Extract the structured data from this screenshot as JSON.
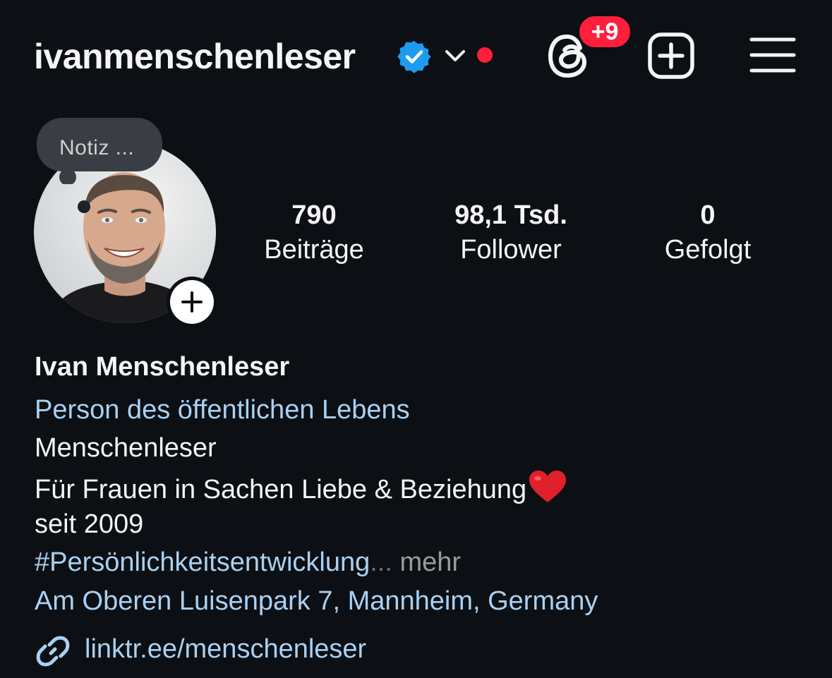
{
  "header": {
    "username": "ivanmenschenleser",
    "notifications_badge": "+9"
  },
  "note": {
    "placeholder": "Notiz ..."
  },
  "stats": [
    {
      "value": "790",
      "label": "Beiträge"
    },
    {
      "value": "98,1 Tsd.",
      "label": "Follower"
    },
    {
      "value": "0",
      "label": "Gefolgt"
    }
  ],
  "bio": {
    "name": "Ivan Menschenleser",
    "category": "Person des öffentlichen Lebens",
    "line1": "Menschenleser",
    "line2": "Für Frauen in Sachen Liebe & Beziehung",
    "line2_emoji": "heart-emoji",
    "line3": "seit 2009",
    "hashtag": "#Persönlichkeitsentwicklung",
    "ellipsis": "...",
    "more": "mehr",
    "address": "Am Oberen Luisenpark 7, Mannheim, Germany",
    "link": "linktr.ee/menschenleser"
  },
  "icons": {
    "verified": "verified-badge-icon",
    "dropdown": "chevron-down-icon",
    "threads": "threads-icon",
    "create": "plus-square-icon",
    "menu": "hamburger-menu-icon",
    "add_story": "plus-icon",
    "link": "link-icon"
  },
  "colors": {
    "background": "#0c0f14",
    "text": "#f5f5f5",
    "link_blue": "#a9d1f2",
    "verified_blue": "#1d9bf0",
    "badge_red": "#ff1f3d",
    "muted": "#9a9a9a"
  }
}
